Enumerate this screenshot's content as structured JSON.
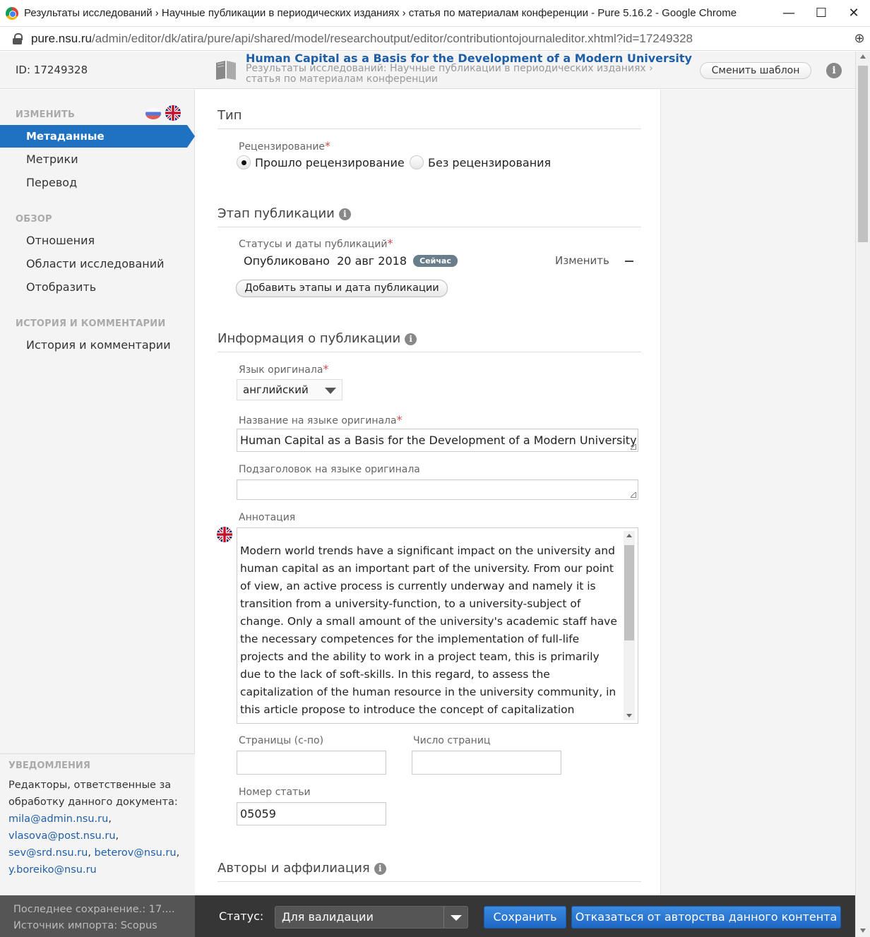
{
  "browser": {
    "window_title": "Результаты исследований › Научные публикации в периодических изданиях › статья по материалам конференции - Pure 5.16.2 - Google Chrome",
    "url_host": "pure.nsu.ru",
    "url_path": "/admin/editor/dk/atira/pure/api/shared/model/researchoutput/editor/contributiontojournaleditor.xhtml?id=17249328",
    "minimize": "—",
    "maximize": "☐",
    "close": "✕",
    "zoom": "⊕"
  },
  "header": {
    "doc_id": "ID: 17249328",
    "doc_title": "Human Capital as a Basis for the Development of a Modern University",
    "doc_type": "Результаты исследований: Научные публикации в периодических изданиях › статья по материалам конференции",
    "change_template": "Сменить шаблон",
    "info": "i"
  },
  "sidebar": {
    "edit_header": "ИЗМЕНИТЬ",
    "edit_items": [
      "Метаданные",
      "Метрики",
      "Перевод"
    ],
    "overview_header": "ОБЗОР",
    "overview_items": [
      "Отношения",
      "Области исследований",
      "Отобразить"
    ],
    "history_header": "ИСТОРИЯ И КОММЕНТАРИИ",
    "history_items": [
      "История и комментарии"
    ],
    "notifications_header": "УВЕДОМЛЕНИЯ",
    "notifications_text": "Редакторы, ответственные за обработку данного документа:",
    "emails": [
      "mila@admin.nsu.ru",
      "vlasova@post.nsu.ru",
      "sev@srd.nsu.ru",
      "beterov@nsu.ru",
      "y.boreiko@nsu.ru"
    ]
  },
  "form": {
    "type_section": "Тип",
    "review_label": "Рецензирование",
    "review_options": [
      "Прошло рецензирование",
      "Без рецензирования"
    ],
    "review_selected": 0,
    "stage_section": "Этап публикации",
    "status_label": "Статусы и даты публикаций",
    "pub_status": "Опубликовано",
    "pub_date": "20 авг 2018",
    "now_badge": "Сейчас",
    "change_link": "Изменить",
    "add_stage_button": "Добавить этапы и дата публикации",
    "info_section": "Информация о публикации",
    "lang_label": "Язык оригинала",
    "lang_value": "английский",
    "title_label": "Название на языке оригинала",
    "title_value": "Human Capital as a Basis for the Development of a Modern University",
    "subtitle_label": "Подзаголовок на языке оригинала",
    "subtitle_value": "",
    "abstract_label": "Аннотация",
    "abstract_text": "Modern world trends have a significant impact on the university and human capital as an important part of the university. From our point of view, an active process is currently underway and namely it is transition from a university-function, to a university-subject of change. Only a small amount of the university's academic staff have the necessary competences for the implementation of full-life projects and the ability to work in a project team, this is primarily due to the lack of soft-skills. In this regard, to assess the capitalization of the human resource in the university community, in this article propose to introduce the concept of capitalization",
    "pages_label": "Страницы (с-по)",
    "pages_value": "",
    "num_pages_label": "Число страниц",
    "num_pages_value": "",
    "article_num_label": "Номер статьи",
    "article_num_value": "05059",
    "authors_section": "Авторы и аффилиация",
    "required_mark": "*"
  },
  "footer": {
    "last_saved": "Последнее сохранение.: 17....",
    "import_source": "Источник импорта: Scopus",
    "status_label": "Статус:",
    "status_value": "Для валидации",
    "save_button": "Сохранить",
    "disclaim_button": "Отказаться от авторства данного контента"
  },
  "colors": {
    "accent": "#1f71c2",
    "link": "#1f5fa8",
    "required": "#d04b4b"
  }
}
